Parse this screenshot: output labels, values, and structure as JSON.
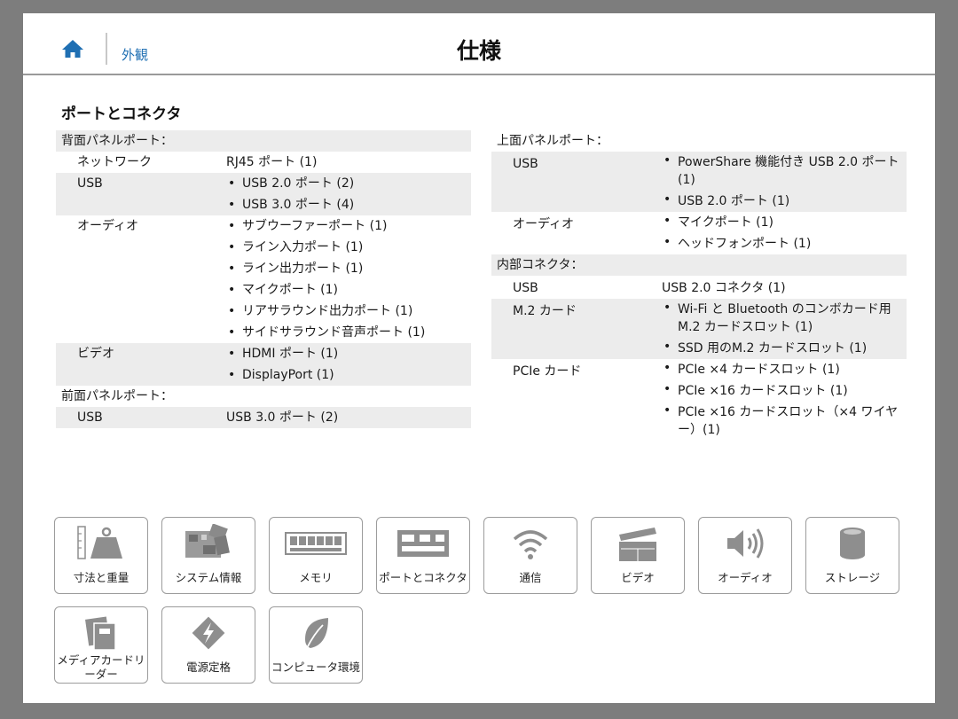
{
  "header": {
    "nav_link": "外観",
    "title": "仕様"
  },
  "section_title": "ポートとコネクタ",
  "left": {
    "rear_panel_heading": "背面パネルポート：",
    "rear_panel": [
      {
        "label": "ネットワーク",
        "text": "RJ45 ポート (1)"
      },
      {
        "label": "USB",
        "items": [
          "USB 2.0 ポート (2)",
          "USB 3.0 ポート (4)"
        ]
      },
      {
        "label": "オーディオ",
        "items": [
          "サブウーファーポート (1)",
          "ライン入力ポート (1)",
          "ライン出力ポート (1)",
          "マイクポート (1)",
          "リアサラウンド出力ポート (1)",
          "サイドサラウンド音声ポート (1)"
        ]
      },
      {
        "label": "ビデオ",
        "items": [
          "HDMI ポート (1)",
          "DisplayPort (1)"
        ]
      }
    ],
    "front_panel_heading": "前面パネルポート：",
    "front_panel": [
      {
        "label": "USB",
        "text": "USB 3.0 ポート (2)"
      }
    ]
  },
  "right": {
    "top_panel_heading": "上面パネルポート：",
    "top_panel": [
      {
        "label": "USB",
        "items": [
          "PowerShare 機能付き USB 2.0 ポート (1)",
          "USB 2.0 ポート (1)"
        ]
      },
      {
        "label": "オーディオ",
        "items": [
          "マイクポート (1)",
          "ヘッドフォンポート (1)"
        ]
      }
    ],
    "internal_heading": "内部コネクタ：",
    "internal": [
      {
        "label": "USB",
        "text": "USB 2.0 コネクタ (1)"
      },
      {
        "label": "M.2 カード",
        "items": [
          "Wi-Fi と Bluetooth のコンボカード用 M.2 カードスロット (1)",
          "SSD 用のM.2 カードスロット (1)"
        ]
      },
      {
        "label": "PCIe カード",
        "items": [
          "PCIe ×4 カードスロット (1)",
          "PCIe ×16 カードスロット (1)",
          "PCIe ×16 カードスロット（×4 ワイヤー）(1)"
        ]
      }
    ]
  },
  "tiles": [
    {
      "label": "寸法と重量",
      "icon": "scale-icon"
    },
    {
      "label": "システム情報",
      "icon": "motherboard-icon"
    },
    {
      "label": "メモリ",
      "icon": "memory-icon"
    },
    {
      "label": "ポートとコネクタ",
      "icon": "ports-icon"
    },
    {
      "label": "通信",
      "icon": "wifi-icon"
    },
    {
      "label": "ビデオ",
      "icon": "clapperboard-icon"
    },
    {
      "label": "オーディオ",
      "icon": "speaker-icon"
    },
    {
      "label": "ストレージ",
      "icon": "storage-icon"
    },
    {
      "label": "メディアカードリーダー",
      "icon": "media-card-icon"
    },
    {
      "label": "電源定格",
      "icon": "power-icon"
    },
    {
      "label": "コンピュータ環境",
      "icon": "leaf-icon"
    }
  ],
  "colors": {
    "link": "#1f6fb3",
    "row_shade": "#ececec",
    "frame": "#7d7d7d",
    "icon_gray": "#8e8e8e"
  }
}
